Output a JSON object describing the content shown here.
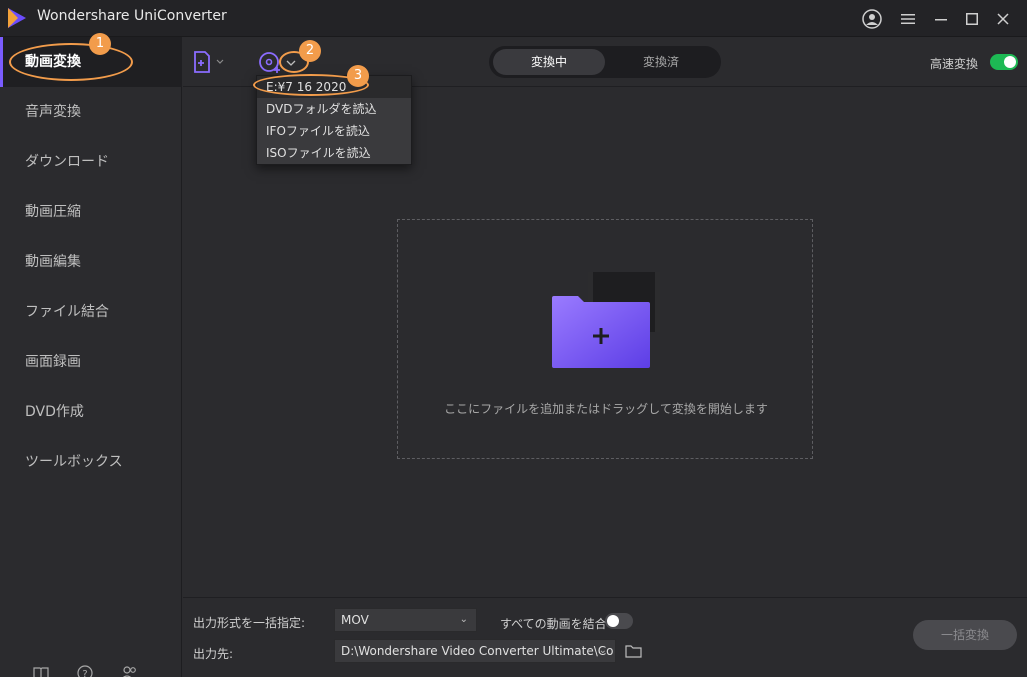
{
  "app": {
    "title": "Wondershare UniConverter"
  },
  "sidebar": {
    "items": [
      {
        "label": "動画変換",
        "active": true
      },
      {
        "label": "音声変換"
      },
      {
        "label": "ダウンロード"
      },
      {
        "label": "動画圧縮"
      },
      {
        "label": "動画編集"
      },
      {
        "label": "ファイル結合"
      },
      {
        "label": "画面録画"
      },
      {
        "label": "DVD作成"
      },
      {
        "label": "ツールボックス"
      }
    ],
    "bottom_icons": [
      "book-icon",
      "help-icon",
      "users-icon"
    ]
  },
  "toolbar": {
    "tabs": [
      {
        "label": "変換中",
        "active": true
      },
      {
        "label": "変換済"
      }
    ],
    "fast_convert_label": "高速変換",
    "fast_convert_on": true
  },
  "dropdown": {
    "items": [
      "E:¥7 16 2020",
      "DVDフォルダを読込",
      "IFOファイルを読込",
      "ISOファイルを読込"
    ]
  },
  "annotations": [
    "1",
    "2",
    "3"
  ],
  "dropzone": {
    "text": "ここにファイルを追加またはドラッグして変換を開始します"
  },
  "bottom": {
    "format_label": "出力形式を一括指定:",
    "format_value": "MOV",
    "merge_label": "すべての動画を結合",
    "merge_on": false,
    "dest_label": "出力先:",
    "dest_value": "D:\\Wondershare Video Converter Ultimate\\Co",
    "convert_all_label": "一括変換"
  },
  "colors": {
    "accent": "#7a5cff",
    "toggle_on": "#1db954",
    "annotation": "#f29c4b"
  }
}
